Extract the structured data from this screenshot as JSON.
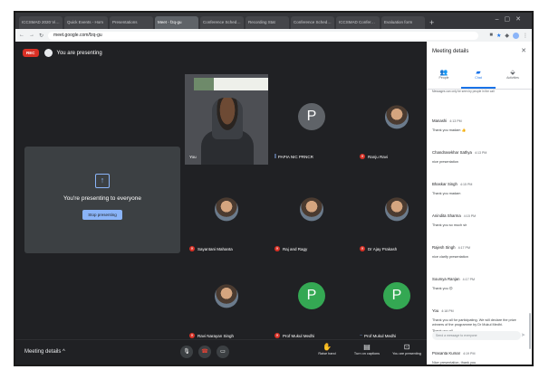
{
  "browser": {
    "tabs": [
      {
        "label": "ICCSMAD 2020 Virtual Sch"
      },
      {
        "label": "Quick Events - Hom"
      },
      {
        "label": "Presentations"
      },
      {
        "label": "Meet - fzq-gu"
      },
      {
        "label": "Conference Schedule"
      },
      {
        "label": "Recording Stat"
      },
      {
        "label": "Conference Schedule"
      },
      {
        "label": "ICCSMAD Conference"
      },
      {
        "label": "Evaluation form"
      }
    ],
    "url": "meet.google.com/fzq-gu"
  },
  "meet": {
    "rec_label": "REC",
    "presenting_label": "You are presenting",
    "present_card": {
      "message": "You're presenting to everyone",
      "stop_button": "Stop presenting"
    },
    "tiles": [
      {
        "name": "You",
        "kind": "self"
      },
      {
        "name": "PAPIA NIC PRNCR",
        "kind": "letter",
        "letter": "P",
        "avatar_color": "#5f6368",
        "muted": false
      },
      {
        "name": "Ranju Ravi",
        "kind": "photo",
        "muted": true
      },
      {
        "name": "Sayantani Mahanta",
        "kind": "photo",
        "muted": true
      },
      {
        "name": "Raj and Ragy",
        "kind": "photo",
        "muted": true
      },
      {
        "name": "Dr Ajay Prakash",
        "kind": "photo",
        "muted": true
      },
      {
        "name": "Ravi Narayan Singh",
        "kind": "photo",
        "muted": true
      },
      {
        "name": "Prof Mukul Medhi",
        "kind": "letter",
        "letter": "P",
        "avatar_color": "#34a853",
        "muted": true
      },
      {
        "name": "Prof Mukul Medhi",
        "kind": "letter",
        "letter": "P",
        "avatar_color": "#34a853",
        "muted": false
      }
    ],
    "bottom": {
      "meeting_details": "Meeting details",
      "raise_hand": "Raise hand",
      "turn_on_captions": "Turn on captions",
      "presenting": "You are presenting"
    }
  },
  "panel": {
    "title": "Meeting details",
    "tabs": [
      "People",
      "Chat",
      "Activities"
    ],
    "note": "Messages can only be seen by people in the call",
    "messages": [
      {
        "sender": "Manashi",
        "time": "4:13 PM",
        "body": "Thank you madam 👍"
      },
      {
        "sender": "Chandrasekhar Sathya",
        "time": "4:13 PM",
        "body": "nice presentation"
      },
      {
        "sender": "Bhaskar Singh",
        "time": "4:15 PM",
        "body": "Thank you madam"
      },
      {
        "sender": "Anindita Sharma",
        "time": "4:15 PM",
        "body": "Thank you so much sir"
      },
      {
        "sender": "Rajesh Singh",
        "time": "4:17 PM",
        "body": "nice clarify presentation"
      },
      {
        "sender": "Soumya Ranjan",
        "time": "4:17 PM",
        "body": "Thank you 😊"
      },
      {
        "sender": "You",
        "time": "4:18 PM",
        "body": "Thank you all for participating. We will declare the prize winners of the programme by Dr Mukul Medhi."
      },
      {
        "sender": "",
        "time": "",
        "body": "Thank you all"
      },
      {
        "sender": "Prasanta Kumar",
        "time": "4:19 PM",
        "body": "Nice presentation, thank you"
      }
    ],
    "input_placeholder": "Send a message to everyone"
  },
  "colors": {
    "accent": "#1a73e8",
    "danger": "#d93025",
    "meet_bg": "#202124"
  }
}
